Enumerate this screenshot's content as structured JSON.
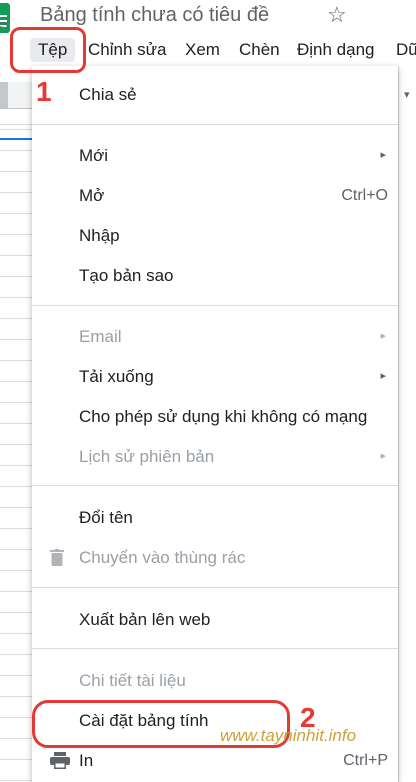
{
  "app": {
    "title": "Bảng tính chưa có tiêu đề",
    "star_icon": "star-outline-icon"
  },
  "menubar": {
    "items": [
      "Tệp",
      "Chỉnh sửa",
      "Xem",
      "Chèn",
      "Định dạng",
      "Dữ"
    ]
  },
  "file_menu": {
    "items": [
      {
        "label": "Chia sẻ",
        "enabled": true
      },
      {
        "label": "Mới",
        "enabled": true,
        "submenu": true
      },
      {
        "label": "Mở",
        "enabled": true,
        "shortcut": "Ctrl+O"
      },
      {
        "label": "Nhập",
        "enabled": true
      },
      {
        "label": "Tạo bản sao",
        "enabled": true
      },
      {
        "label": "Email",
        "enabled": false,
        "submenu": true
      },
      {
        "label": "Tải xuống",
        "enabled": true,
        "submenu": true
      },
      {
        "label": "Cho phép sử dụng khi không có mạng",
        "enabled": true
      },
      {
        "label": "Lịch sử phiên bản",
        "enabled": false,
        "submenu": true
      },
      {
        "label": "Đổi tên",
        "enabled": true
      },
      {
        "label": "Chuyển vào thùng rác",
        "enabled": false,
        "icon": "trash-icon"
      },
      {
        "label": "Xuất bản lên web",
        "enabled": true
      },
      {
        "label": "Chi tiết tài liệu",
        "enabled": false
      },
      {
        "label": "Cài đặt bảng tính",
        "enabled": true
      },
      {
        "label": "In",
        "enabled": true,
        "shortcut": "Ctrl+P",
        "icon": "printer-icon"
      }
    ],
    "submenu_arrow": "▸"
  },
  "annotations": {
    "step1": "1",
    "step2": "2",
    "color": "#e53935"
  },
  "watermark": "www.tayninhit.info",
  "colors": {
    "sheets_green": "#0f9d58",
    "selection_blue": "#1a73e8",
    "disabled_text": "#9aa0a6"
  }
}
